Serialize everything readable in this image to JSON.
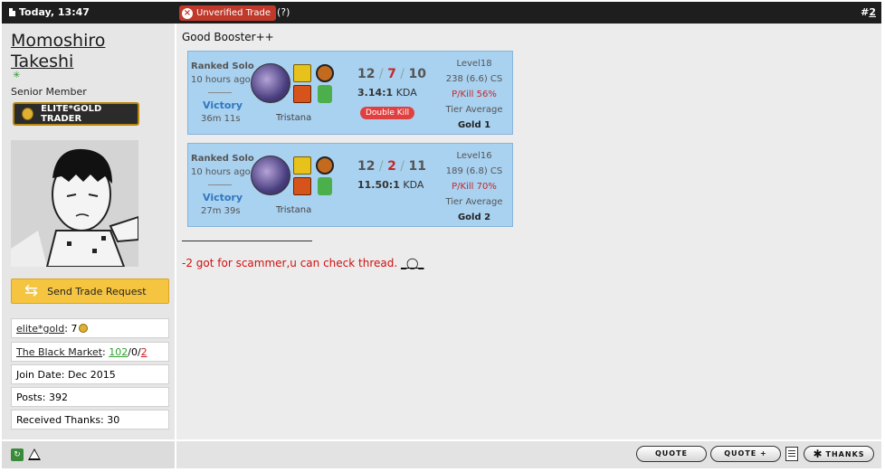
{
  "topbar": {
    "date": "Today, 13:47",
    "unverified_label": "Unverified Trade",
    "help": "(?)",
    "post_number_prefix": "#",
    "post_number": "2"
  },
  "user": {
    "name_line1": "Momoshiro",
    "name_line2": "Takeshi",
    "title": "Senior Member",
    "badge_label": "ELITE*GOLD TRADER",
    "trade_button": "Send Trade Request",
    "stats": {
      "egold_label": "elite*gold",
      "egold_value": ": 7",
      "market_label": "The Black Market",
      "market_sep": ": ",
      "market_pos": "102",
      "market_neu": "/0/",
      "market_neg": "2",
      "join_date": "Join Date: Dec 2015",
      "posts": "Posts: 392",
      "thanks": "Received Thanks: 30"
    }
  },
  "post": {
    "title": "Good Booster++",
    "matches": [
      {
        "type": "Ranked Solo",
        "ago": "10 hours ago",
        "result": "Victory",
        "duration": "36m 11s",
        "champion": "Tristana",
        "kills": "12",
        "deaths": "7",
        "assists": "10",
        "kda": "3.14:1",
        "kda_suffix": " KDA",
        "multikill": "Double Kill",
        "level": "Level18",
        "cs": "238 (6.6) CS",
        "pkill": "P/Kill 56%",
        "tier_label": "Tier Average",
        "tier": "Gold 1"
      },
      {
        "type": "Ranked Solo",
        "ago": "10 hours ago",
        "result": "Victory",
        "duration": "27m 39s",
        "champion": "Tristana",
        "kills": "12",
        "deaths": "2",
        "assists": "11",
        "kda": "11.50:1",
        "kda_suffix": " KDA",
        "multikill": "",
        "level": "Level16",
        "cs": "189 (6.8) CS",
        "pkill": "P/Kill 70%",
        "tier_label": "Tier Average",
        "tier": "Gold 2"
      }
    ],
    "signature_text": "-2 got for scammer,u can check thread.",
    "signature_face": "_◯_"
  },
  "footer": {
    "quote": "QUOTE",
    "quote_plus": "QUOTE +",
    "thanks": "THANKS"
  },
  "icons": [
    "doc-icon",
    "close-circle-icon",
    "coin-icon",
    "trade-arrows-icon",
    "report-icon",
    "warning-icon",
    "multiquote-icon",
    "star-icon",
    "flash-spell-icon",
    "ignite-spell-icon",
    "item-icon"
  ],
  "colors": {
    "topbar": "#1e1e1e",
    "unverified": "#c0392b",
    "match_bg": "#a9d1f0",
    "victory": "#2f78c0",
    "deaths": "#c62828",
    "signature": "#d01010",
    "trade_button": "#f5c542"
  }
}
